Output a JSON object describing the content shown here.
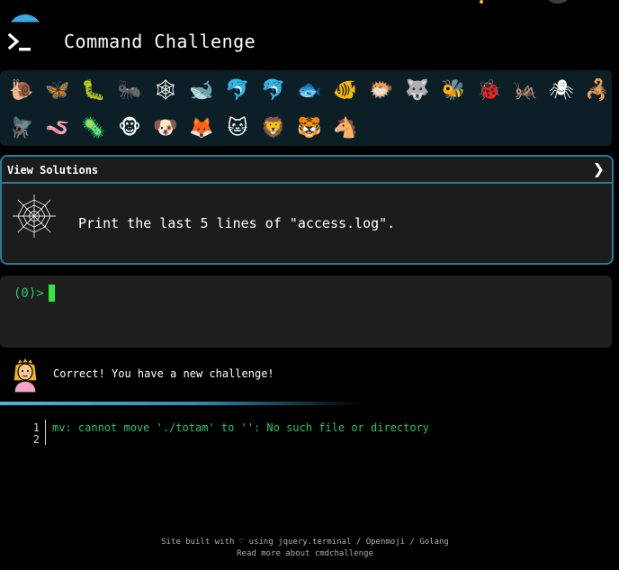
{
  "header": {
    "title": "Command Challenge",
    "logo_icon": "terminal-prompt-icon"
  },
  "animals": {
    "row1": [
      "🐌",
      "🦋",
      "🐛",
      "🐜",
      "🕸",
      "🐋",
      "🐬",
      "🐬",
      "🐟",
      "🐠",
      "🐡",
      "🐺",
      "🐝",
      "🐞",
      "🦗",
      "🕷",
      "🦂"
    ],
    "row2": [
      "🪰",
      "🪱",
      "🦠",
      "🐵",
      "🐶",
      "🦊",
      "🐱",
      "🦁",
      "🐯",
      "🐴"
    ]
  },
  "challenge": {
    "view_solutions_label": "View Solutions",
    "chevron": "❯",
    "icon": "spider-web-icon",
    "description": "Print the last 5 lines of \"access.log\"."
  },
  "terminal": {
    "prompt": "(0)>"
  },
  "feedback": {
    "avatar_icon": "princess-icon",
    "message": "Correct! You have a new challenge!"
  },
  "output": {
    "lines": [
      {
        "num": "1",
        "text": "mv: cannot move './totam' to '': No such file or directory"
      },
      {
        "num": "2",
        "text": ""
      }
    ]
  },
  "footer": {
    "line1": "Site built with ♡ using jquery.terminal / Openmoji / Golang",
    "line2": "Read more about cmdchallenge"
  },
  "colors": {
    "accent": "#2a7a96",
    "prompt_green": "#29c46a",
    "cursor_green": "#31e83f",
    "strip_bg": "#0c1f26"
  }
}
